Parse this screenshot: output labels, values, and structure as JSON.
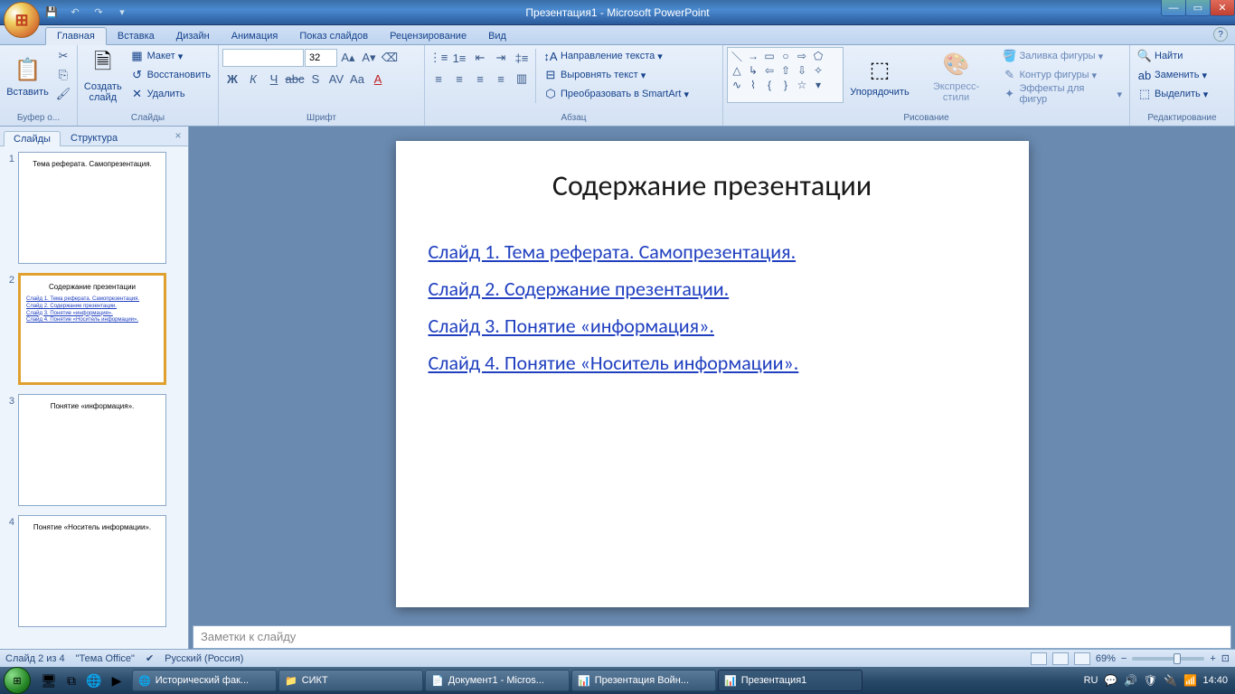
{
  "title": "Презентация1 - Microsoft PowerPoint",
  "tabs": {
    "home": "Главная",
    "insert": "Вставка",
    "design": "Дизайн",
    "anim": "Анимация",
    "show": "Показ слайдов",
    "review": "Рецензирование",
    "view": "Вид"
  },
  "ribbon": {
    "clipboard": {
      "paste": "Вставить",
      "label": "Буфер о..."
    },
    "slides": {
      "new": "Создать\nслайд",
      "layout": "Макет",
      "reset": "Восстановить",
      "delete": "Удалить",
      "label": "Слайды"
    },
    "font": {
      "size": "32",
      "label": "Шрифт"
    },
    "para": {
      "dir": "Направление текста",
      "align": "Выровнять текст",
      "smart": "Преобразовать в SmartArt",
      "label": "Абзац"
    },
    "draw": {
      "arrange": "Упорядочить",
      "styles": "Экспресс-стили",
      "fill": "Заливка фигуры",
      "outline": "Контур фигуры",
      "effects": "Эффекты для фигур",
      "label": "Рисование"
    },
    "edit": {
      "find": "Найти",
      "replace": "Заменить",
      "select": "Выделить",
      "label": "Редактирование"
    }
  },
  "panel": {
    "slides": "Слайды",
    "outline": "Структура"
  },
  "thumbs": [
    {
      "n": "1",
      "title": "Тема реферата. Самопрезентация."
    },
    {
      "n": "2",
      "title": "Содержание презентации",
      "links": [
        "Слайд 1. Тема реферата. Самопрезентация.",
        "Слайд 2. Содержание презентации.",
        "Слайд 3. Понятие «информация».",
        "Слайд 4. Понятие «Носитель информации»."
      ]
    },
    {
      "n": "3",
      "title": "Понятие «информация»."
    },
    {
      "n": "4",
      "title": "Понятие «Носитель информации»."
    }
  ],
  "slide": {
    "title": "Содержание презентации",
    "links": [
      "Слайд 1. Тема реферата. Самопрезентация.",
      "Слайд 2. Содержание презентации.",
      "Слайд 3. Понятие «информация».",
      "Слайд 4. Понятие «Носитель информации»."
    ]
  },
  "notes": "Заметки к слайду",
  "status": {
    "slide": "Слайд 2 из 4",
    "theme": "\"Тема Office\"",
    "lang": "Русский (Россия)",
    "zoom": "69%"
  },
  "taskbar": {
    "items": [
      {
        "icon": "🌐",
        "label": "Исторический фак..."
      },
      {
        "icon": "📁",
        "label": "СИКТ"
      },
      {
        "icon": "📄",
        "label": "Документ1 - Micros..."
      },
      {
        "icon": "📊",
        "label": "Презентация Войн..."
      },
      {
        "icon": "📊",
        "label": "Презентация1"
      }
    ],
    "lang": "RU",
    "time": "14:40"
  }
}
